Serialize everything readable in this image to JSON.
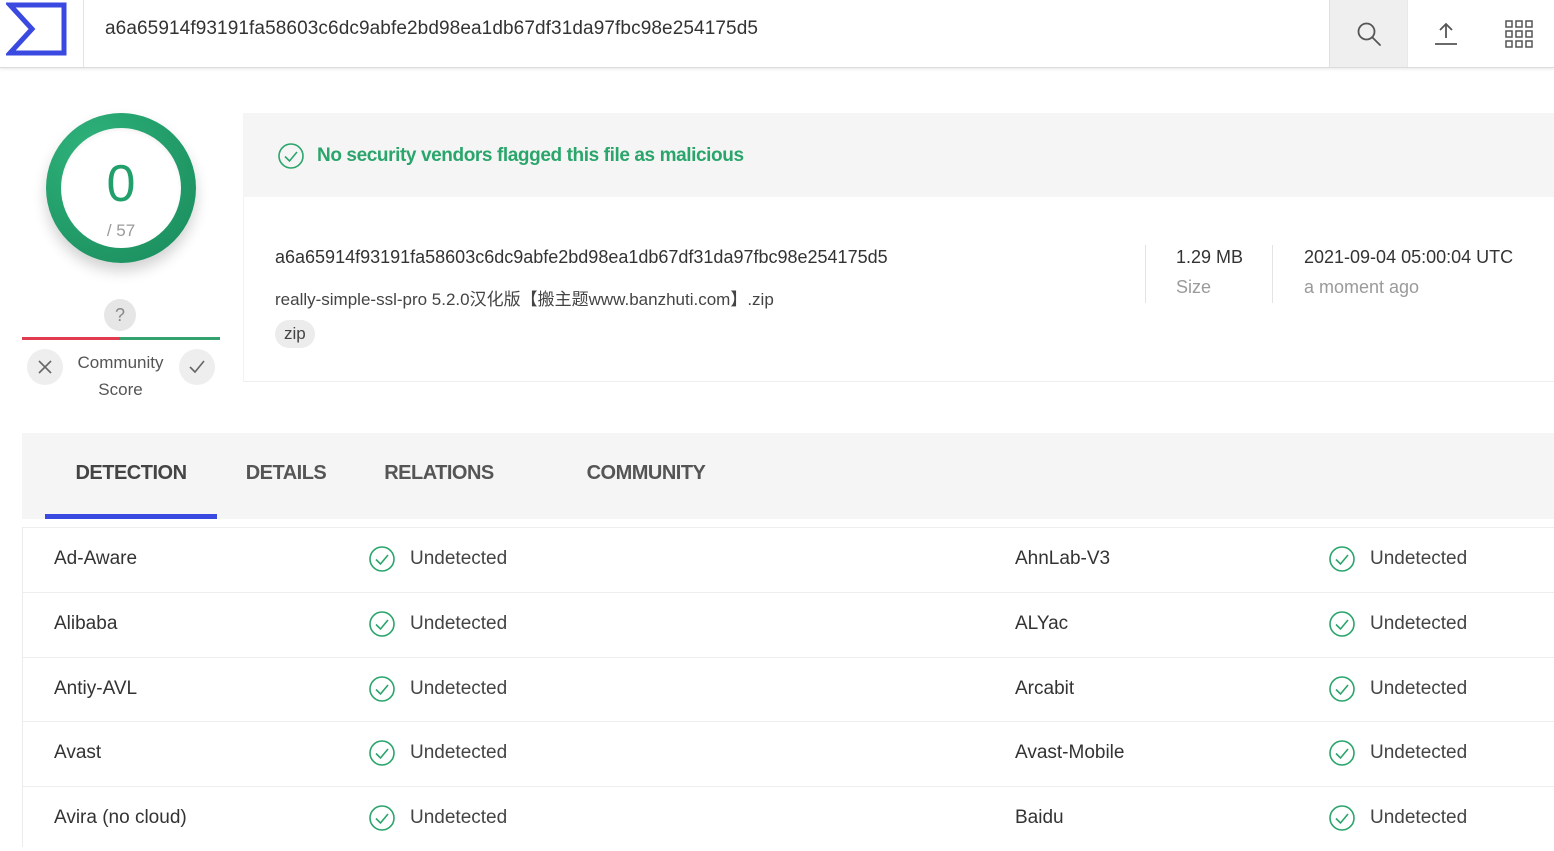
{
  "header": {
    "search_value": "a6a65914f93191fa58603c6dc9abfe2bd98ea1db67df31da97fbc98e254175d5"
  },
  "score": {
    "detections": "0",
    "total": "/ 57"
  },
  "community": {
    "question": "?",
    "label_line1": "Community",
    "label_line2": "Score"
  },
  "banner": {
    "message": "No security vendors flagged this file as malicious"
  },
  "file": {
    "hash": "a6a65914f93191fa58603c6dc9abfe2bd98ea1db67df31da97fbc98e254175d5",
    "name": "really-simple-ssl-pro 5.2.0汉化版【搬主题www.banzhuti.com】.zip",
    "tag": "zip",
    "size_value": "1.29 MB",
    "size_label": "Size",
    "date_value": "2021-09-04 05:00:04 UTC",
    "date_label": "a moment ago"
  },
  "tabs": [
    {
      "label": "DETECTION"
    },
    {
      "label": "DETAILS"
    },
    {
      "label": "RELATIONS"
    },
    {
      "label": "COMMUNITY"
    }
  ],
  "detections": [
    {
      "left_engine": "Ad-Aware",
      "left_result": "Undetected",
      "right_engine": "AhnLab-V3",
      "right_result": "Undetected"
    },
    {
      "left_engine": "Alibaba",
      "left_result": "Undetected",
      "right_engine": "ALYac",
      "right_result": "Undetected"
    },
    {
      "left_engine": "Antiy-AVL",
      "left_result": "Undetected",
      "right_engine": "Arcabit",
      "right_result": "Undetected"
    },
    {
      "left_engine": "Avast",
      "left_result": "Undetected",
      "right_engine": "Avast-Mobile",
      "right_result": "Undetected"
    },
    {
      "left_engine": "Avira (no cloud)",
      "left_result": "Undetected",
      "right_engine": "Baidu",
      "right_result": "Undetected"
    }
  ],
  "icons": {
    "logo": "virustotal-logo-icon",
    "search": "search-icon",
    "upload": "upload-icon",
    "apps": "grid-icon",
    "check": "check-circle-icon",
    "vote_down": "close-icon",
    "vote_up": "checkmark-icon"
  },
  "colors": {
    "brand": "#3a49e0",
    "clean_green": "#22a06b",
    "malicious_red": "#e13b4f"
  }
}
